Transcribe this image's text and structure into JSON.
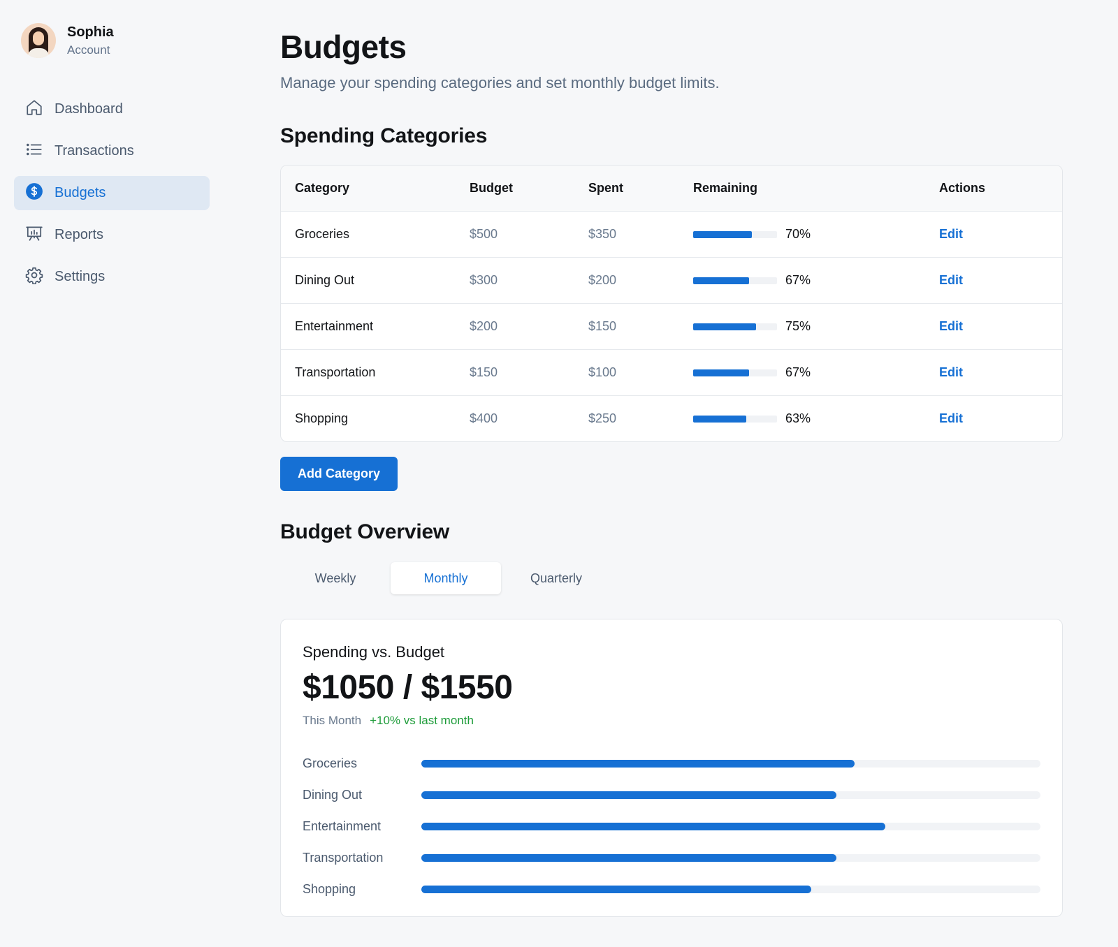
{
  "profile": {
    "name": "Sophia",
    "subtitle": "Account"
  },
  "nav": [
    {
      "label": "Dashboard",
      "icon": "home-icon",
      "active": false
    },
    {
      "label": "Transactions",
      "icon": "list-icon",
      "active": false
    },
    {
      "label": "Budgets",
      "icon": "dollar-icon",
      "active": true
    },
    {
      "label": "Reports",
      "icon": "presentation-chart-icon",
      "active": false
    },
    {
      "label": "Settings",
      "icon": "gear-icon",
      "active": false
    }
  ],
  "page": {
    "title": "Budgets",
    "subtitle": "Manage your spending categories and set monthly budget limits."
  },
  "categories_section": {
    "title": "Spending Categories",
    "columns": [
      "Category",
      "Budget",
      "Spent",
      "Remaining",
      "Actions"
    ],
    "rows": [
      {
        "category": "Groceries",
        "budget": "$500",
        "spent": "$350",
        "remaining_pct": 70,
        "remaining_label": "70%",
        "action": "Edit"
      },
      {
        "category": "Dining Out",
        "budget": "$300",
        "spent": "$200",
        "remaining_pct": 67,
        "remaining_label": "67%",
        "action": "Edit"
      },
      {
        "category": "Entertainment",
        "budget": "$200",
        "spent": "$150",
        "remaining_pct": 75,
        "remaining_label": "75%",
        "action": "Edit"
      },
      {
        "category": "Transportation",
        "budget": "$150",
        "spent": "$100",
        "remaining_pct": 67,
        "remaining_label": "67%",
        "action": "Edit"
      },
      {
        "category": "Shopping",
        "budget": "$400",
        "spent": "$250",
        "remaining_pct": 63,
        "remaining_label": "63%",
        "action": "Edit"
      }
    ],
    "add_button": "Add Category"
  },
  "overview_section": {
    "title": "Budget Overview",
    "tabs": [
      {
        "label": "Weekly",
        "active": false
      },
      {
        "label": "Monthly",
        "active": true
      },
      {
        "label": "Quarterly",
        "active": false
      }
    ],
    "card": {
      "label": "Spending vs. Budget",
      "value": "$1050 / $1550",
      "period": "This Month",
      "delta": "+10% vs last month"
    }
  },
  "chart_data": {
    "type": "bar",
    "orientation": "horizontal",
    "categories": [
      "Groceries",
      "Dining Out",
      "Entertainment",
      "Transportation",
      "Shopping"
    ],
    "values": [
      70,
      67,
      75,
      67,
      63
    ],
    "xlim": [
      0,
      100
    ]
  },
  "colors": {
    "accent": "#1670d4",
    "positive": "#1e9c3a",
    "background": "#f6f7f9"
  }
}
